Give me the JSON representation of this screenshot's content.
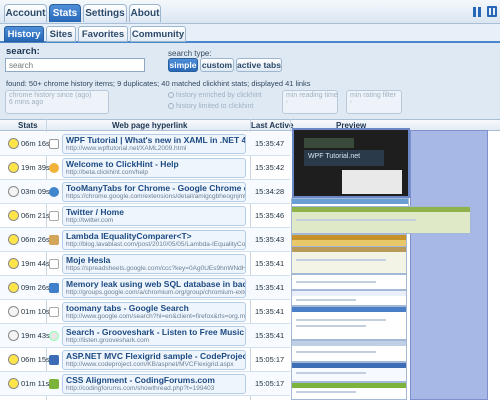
{
  "top_tabs": [
    {
      "label": "Account",
      "active": false
    },
    {
      "label": "Stats",
      "active": true
    },
    {
      "label": "Settings",
      "active": false
    },
    {
      "label": "About",
      "active": false
    }
  ],
  "sub_tabs": [
    {
      "label": "History",
      "active": true
    },
    {
      "label": "Sites",
      "active": false
    },
    {
      "label": "Favorites",
      "active": false
    },
    {
      "label": "Community",
      "active": false
    }
  ],
  "search": {
    "label": "search:",
    "placeholder": "search"
  },
  "search_type": {
    "label": "search type:",
    "options": [
      {
        "label": "simple",
        "active": true
      },
      {
        "label": "custom",
        "active": false
      },
      {
        "label": "active tabs",
        "active": false
      }
    ]
  },
  "found_text": "found: 50+ chrome history items; 9 duplicates; 40 matched clickhint stats; displayed 41 links",
  "filters": {
    "history_since_label": "chrome history since (ago)",
    "history_since_value": "6 mins ago",
    "enriched_label": "history enriched by clickhint",
    "limited_label": "history limited to clickhint",
    "min_reading_label": "min reading time",
    "min_reading_value": "-",
    "min_rating_label": "min rating filter",
    "min_rating_value": "-"
  },
  "table": {
    "headers": {
      "stats": "Stats",
      "url": "Web page hyperlink",
      "last_active": "Last Active",
      "preview": "Preview"
    },
    "rows": [
      {
        "stat": "06m 16s",
        "fill": "full",
        "icon": "ie-icon",
        "title": "WPF Tutorial | What's new in XAML in .NET 4.0",
        "url": "http://www.wpftutorial.net/XAML2009.html",
        "time": "15:35:47"
      },
      {
        "stat": "19m 39s",
        "fill": "full",
        "icon": "bolt-icon",
        "title": "Welcome to ClickHint - Help",
        "url": "http://beta.clickhint.com/help",
        "time": "15:35:42"
      },
      {
        "stat": "03m 09s",
        "fill": "empty",
        "icon": "star-icon",
        "title": "TooManyTabs for Chrome - Google Chrome extensio",
        "url": "https://chrome.google.com/extensions/detail/amigcgbheognjmfk",
        "time": "15:34:28"
      },
      {
        "stat": "06m 21s",
        "fill": "full",
        "icon": "t-icon",
        "title": "Twitter / Home",
        "url": "http://twitter.com",
        "time": "15:35:46"
      },
      {
        "stat": "06m 26s",
        "fill": "full",
        "icon": "l-icon",
        "title": "Lambda IEqualityComparer<T>",
        "url": "http://blog.lavablast.com/post/2010/05/05/Lambda-IEqualityComp",
        "time": "15:35:43"
      },
      {
        "stat": "19m 44s",
        "fill": "full",
        "icon": "g-icon",
        "title": "Moje Hesla",
        "url": "https://spreadsheets.google.com/ccc?key=0Ag0UEs9hnWNdHp2",
        "time": "15:35:41"
      },
      {
        "stat": "09m 26s",
        "fill": "full",
        "icon": "grid-icon",
        "title": "Memory leak using web SQL database in backgroun",
        "url": "http://groups.google.com/a/chromium.org/group/chromium-exten",
        "time": "15:35:41"
      },
      {
        "stat": "01m 10s",
        "fill": "empty",
        "icon": "g-icon",
        "title": "toomany tabs - Google Search",
        "url": "http://www.google.com/search?hl=en&client=firefox&rls=org.mo",
        "time": "15:35:41"
      },
      {
        "stat": "19m 43s",
        "fill": "empty",
        "icon": "gs-icon",
        "title": "Search - Grooveshark - Listen to Free Music Online",
        "url": "http://listen.grooveshark.com",
        "time": "15:35:41"
      },
      {
        "stat": "06m 15s",
        "fill": "full",
        "icon": "asp-icon",
        "title": "ASP.NET MVC Flexigrid sample - CodeProject",
        "url": "http://www.codeproject.com/KB/aspnet/MVCFlexigrid.aspx",
        "time": "15:05:17"
      },
      {
        "stat": "01m 11s",
        "fill": "full",
        "icon": "css-icon",
        "title": "CSS Alignment - CodingForums.com",
        "url": "http://codingforums.com/showthread.php?t=199403",
        "time": "15:05:17"
      }
    ]
  },
  "preview": {
    "main_title": "WPF Tutorial.net"
  }
}
